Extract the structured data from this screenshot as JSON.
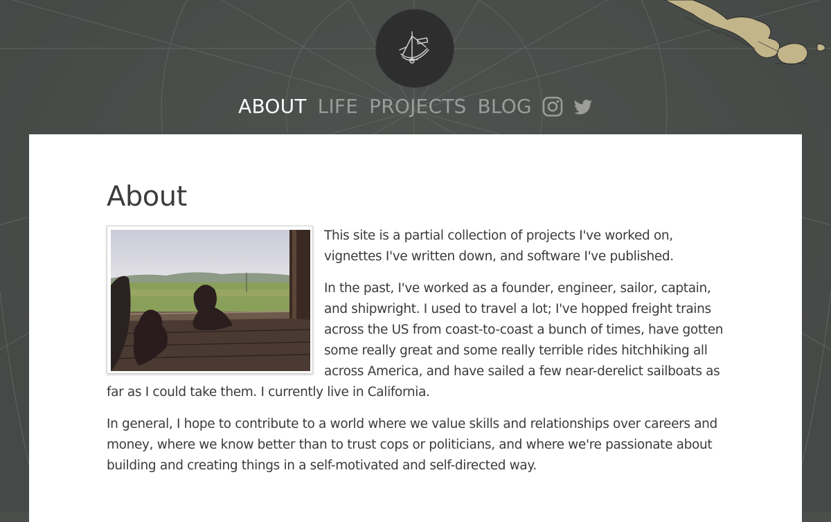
{
  "nav": {
    "items": [
      {
        "label": "ABOUT",
        "active": true
      },
      {
        "label": "LIFE",
        "active": false
      },
      {
        "label": "PROJECTS",
        "active": false
      },
      {
        "label": "BLOG",
        "active": false
      }
    ],
    "icons": [
      "instagram-icon",
      "twitter-icon"
    ]
  },
  "logo": {
    "icon": "sextant-icon"
  },
  "page": {
    "title": "About",
    "paragraphs": [
      "This site is a partial collection of projects I've worked on, vignettes I've written down, and software I've published.",
      "In the past, I've worked as a founder, engineer, sailor, captain, and shipwright. I used to travel a lot; I've hopped freight trains across the US from coast-to-coast a bunch of times, have gotten some really great and some really terrible rides hitchhiking all across America, and have sailed a few near-derelict sailboats as far as I could take them. I currently live in California.",
      "In general, I hope to contribute to a world where we value skills and relationships over careers and money, where we know better than to trust cops or politicians, and where we're passionate about building and creating things in a self-motivated and self-directed way."
    ]
  },
  "colors": {
    "background": "#4a4e4b",
    "nav_active": "#ffffff",
    "nav_inactive": "#9c9d9a",
    "panel": "#ffffff",
    "text": "#3a3a3a",
    "map_land": "#c2b58a"
  }
}
